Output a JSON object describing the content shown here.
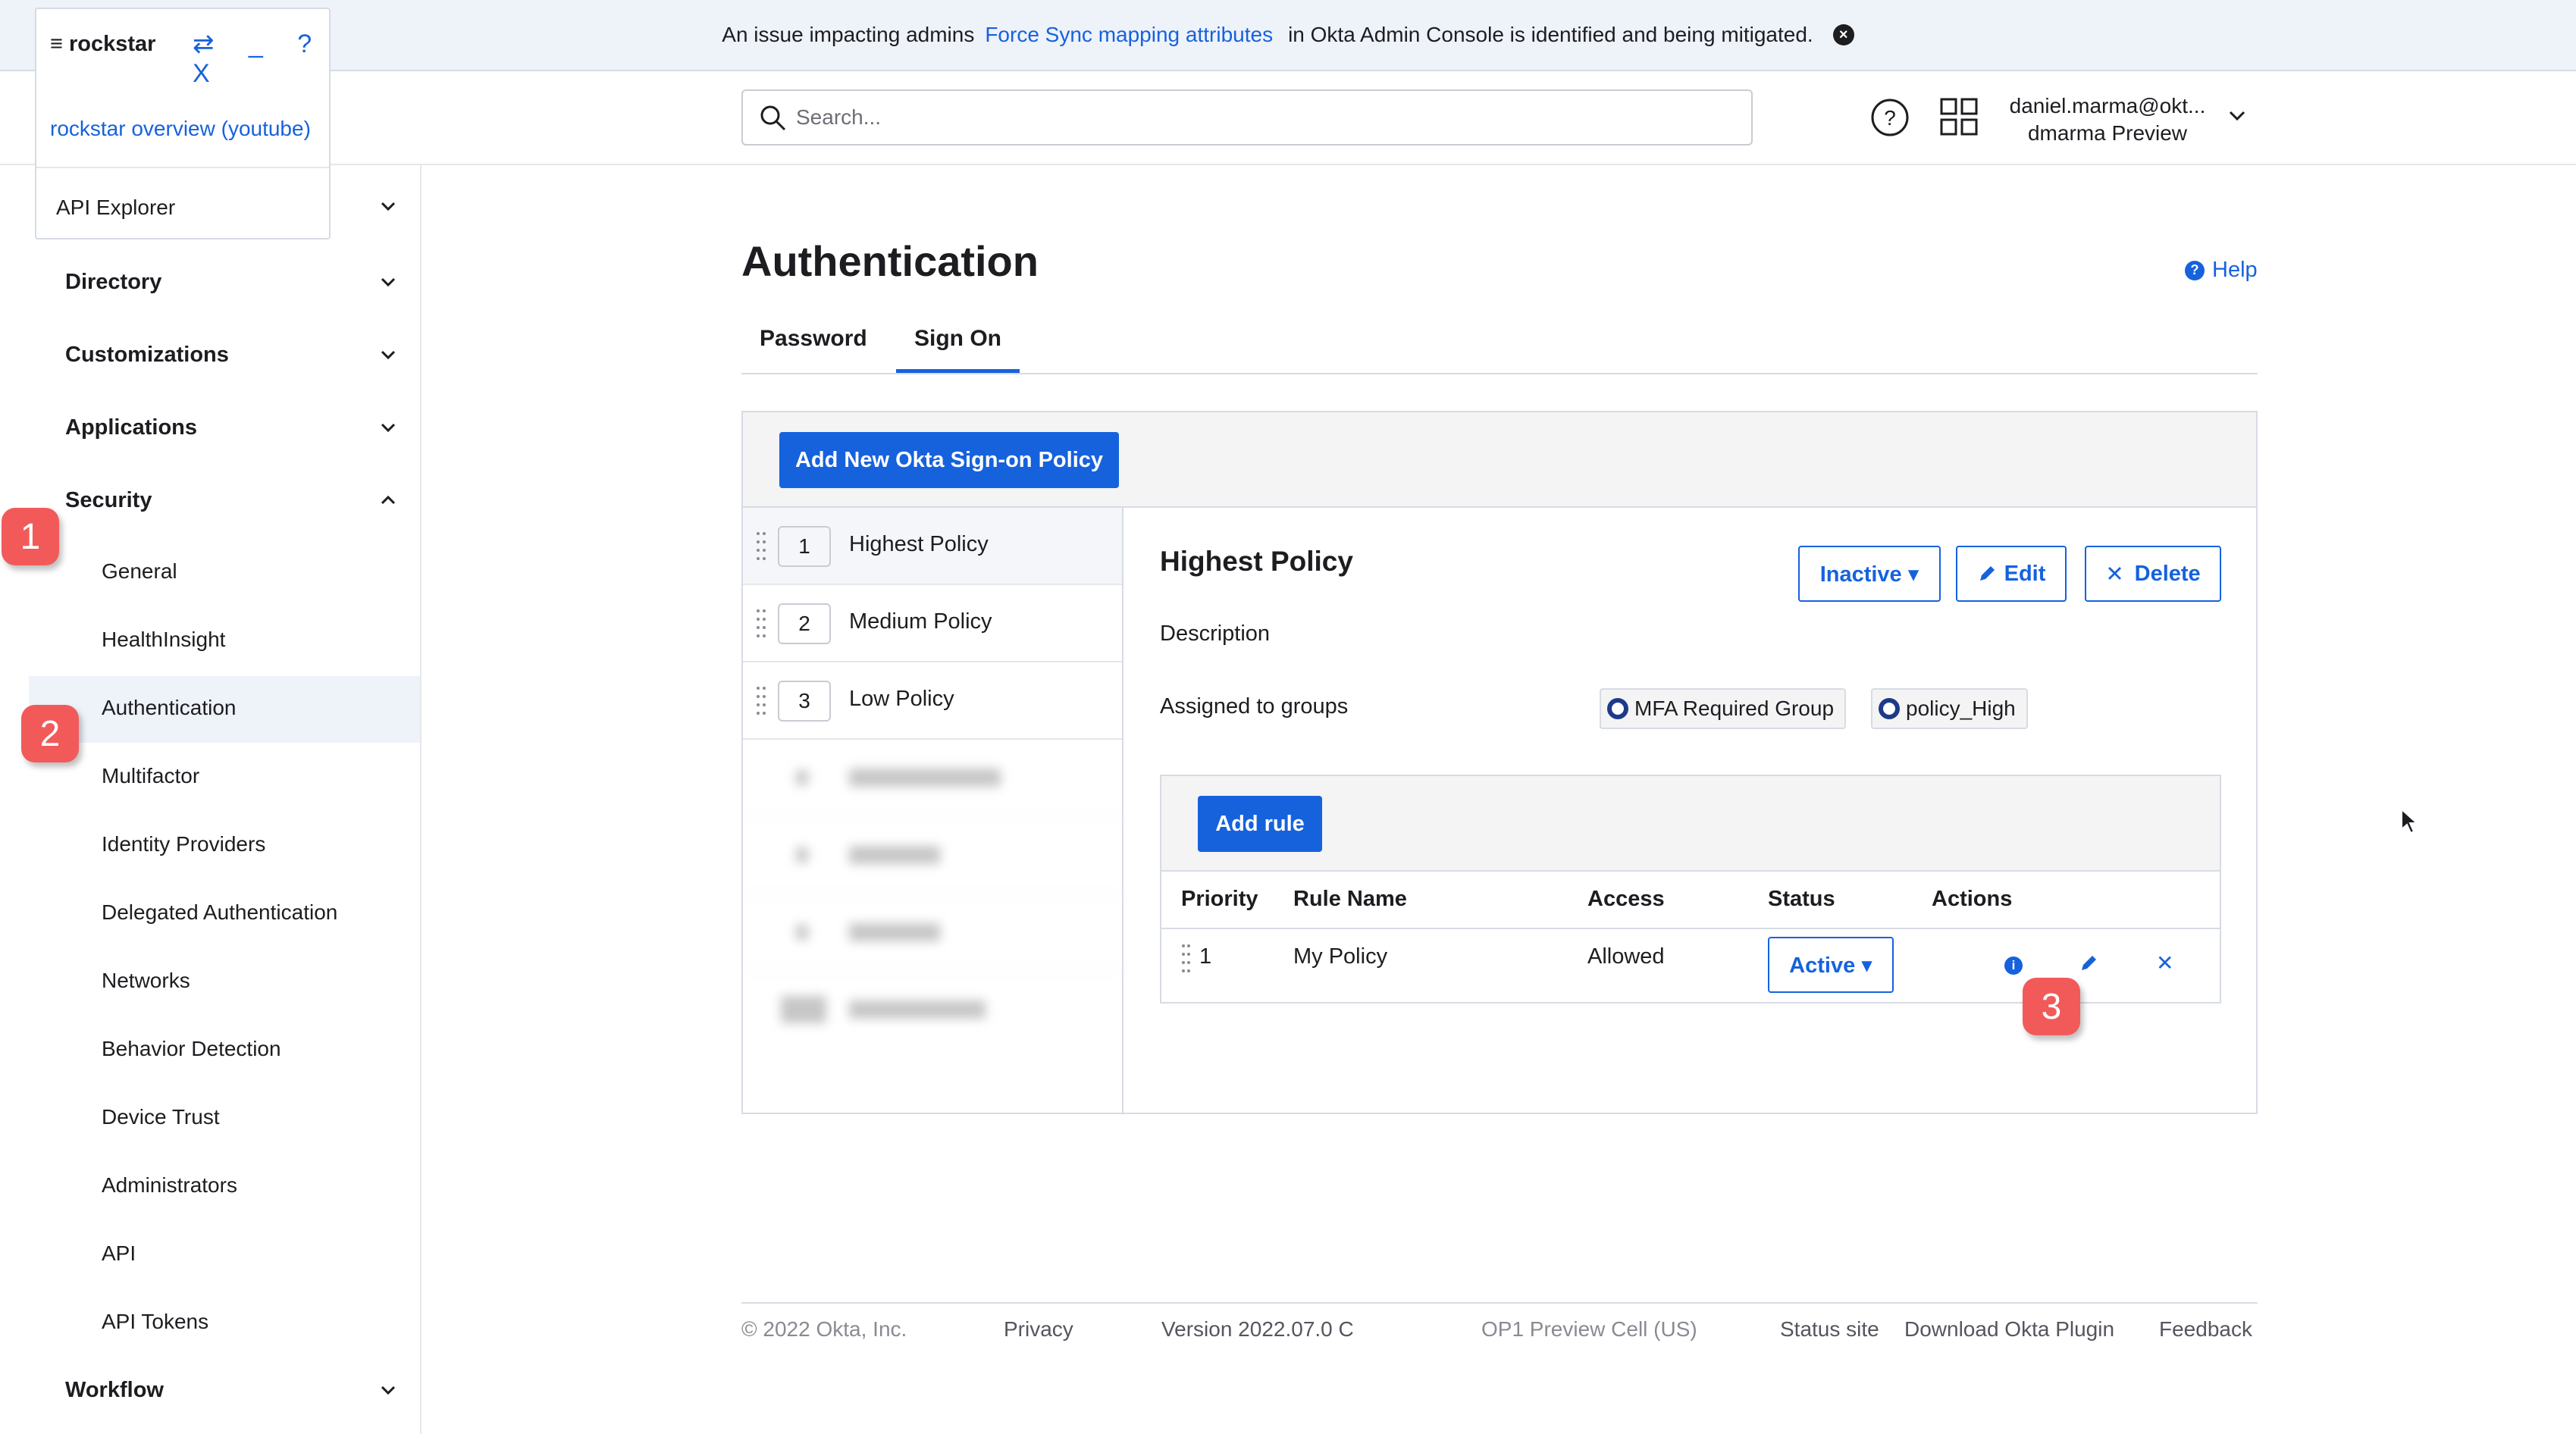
{
  "banner": {
    "text_before": "An issue impacting admins",
    "link": "Force Sync mapping attributes",
    "text_after": "in Okta Admin Console is identified and being mitigated."
  },
  "header": {
    "search_placeholder": "Search...",
    "user_email": "daniel.marma@okt...",
    "user_org": "dmarma Preview"
  },
  "popup": {
    "title": "≡ rockstar",
    "controls": "⇄ _ ? X",
    "link": "rockstar overview (youtube)",
    "api_explorer": "API Explorer"
  },
  "sidebar": {
    "sections": [
      "Directory",
      "Customizations",
      "Applications",
      "Security",
      "Workflow"
    ],
    "security_items": [
      "General",
      "HealthInsight",
      "Authentication",
      "Multifactor",
      "Identity Providers",
      "Delegated Authentication",
      "Networks",
      "Behavior Detection",
      "Device Trust",
      "Administrators",
      "API",
      "API Tokens"
    ]
  },
  "badges": [
    "1",
    "2",
    "3"
  ],
  "main": {
    "title": "Authentication",
    "help": "Help",
    "tabs": [
      "Password",
      "Sign On"
    ],
    "add_policy_button": "Add New Okta Sign-on Policy",
    "policies": [
      {
        "num": "1",
        "name": "Highest Policy"
      },
      {
        "num": "2",
        "name": "Medium Policy"
      },
      {
        "num": "3",
        "name": "Low Policy"
      }
    ],
    "detail": {
      "title": "Highest Policy",
      "status_button": "Inactive ▾",
      "edit_button": "Edit",
      "delete_button": "Delete",
      "description_label": "Description",
      "groups_label": "Assigned to groups",
      "groups": [
        "MFA Required Group",
        "policy_High"
      ],
      "add_rule_button": "Add rule",
      "rule_headers": [
        "Priority",
        "Rule Name",
        "Access",
        "Status",
        "Actions"
      ],
      "rule": {
        "priority": "1",
        "name": "My Policy",
        "access": "Allowed",
        "status": "Active ▾"
      }
    }
  },
  "footer": {
    "copyright": "© 2022 Okta, Inc.",
    "privacy": "Privacy",
    "version": "Version 2022.07.0 C",
    "cell": "OP1 Preview Cell (US)",
    "status": "Status site",
    "plugin": "Download Okta Plugin",
    "feedback": "Feedback"
  },
  "colors": {
    "accent": "#1662dd",
    "badge": "#f25a5a"
  }
}
